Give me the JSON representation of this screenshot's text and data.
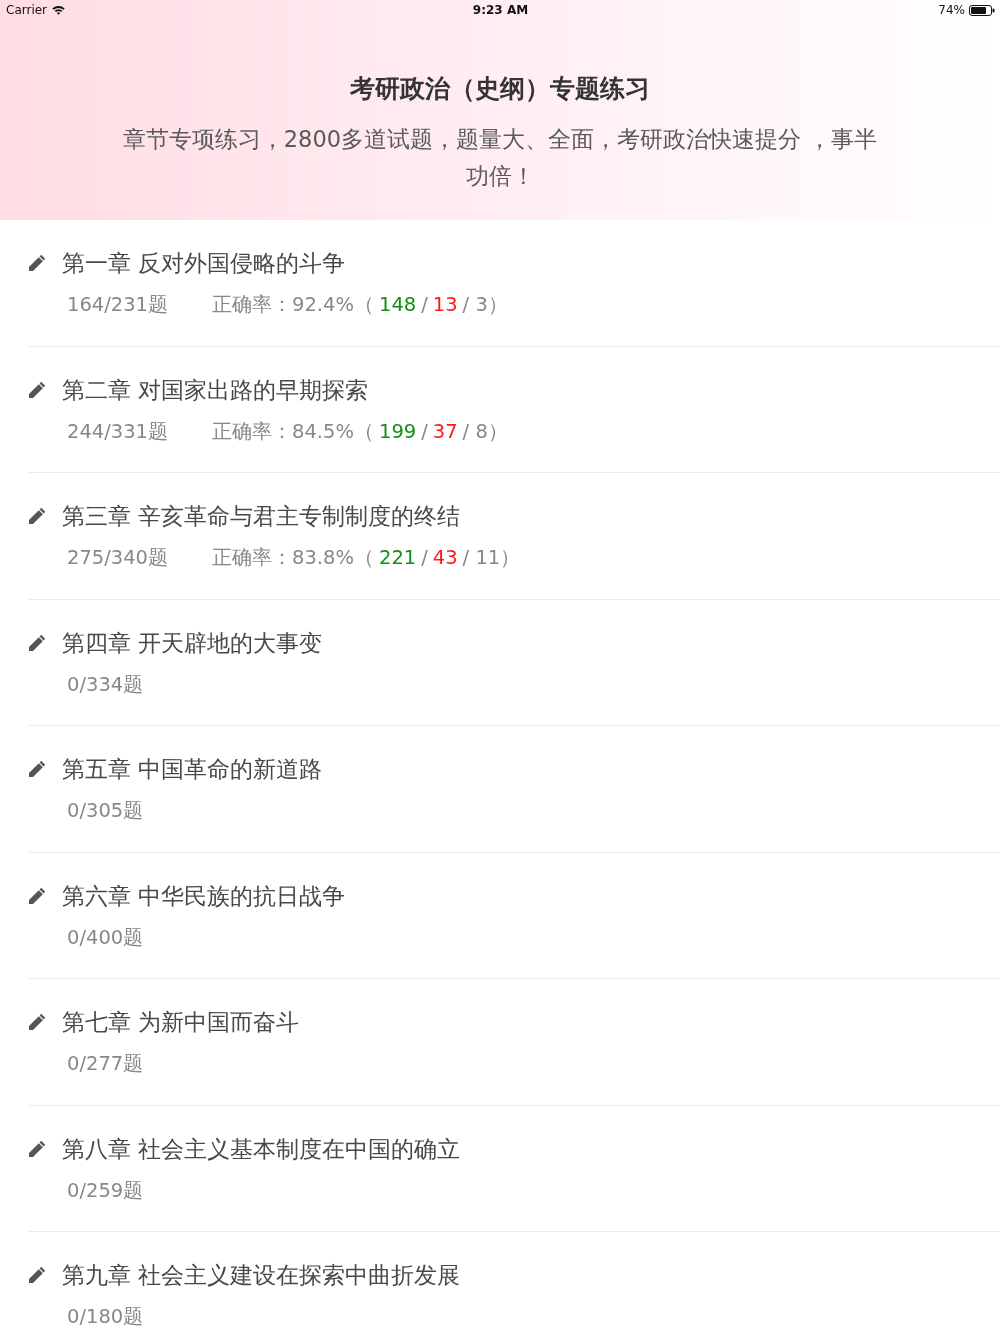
{
  "status_bar": {
    "carrier": "Carrier",
    "time": "9:23 AM",
    "battery": "74%"
  },
  "header": {
    "title": "考研政治（史纲）专题练习",
    "subtitle": "章节专项练习，2800多道试题，题量大、全面，考研政治快速提分 ，事半功倍！"
  },
  "chapters": [
    {
      "title": "第一章 反对外国侵略的斗争",
      "count": "164/231题",
      "stats": [
        {
          "kind": "plain",
          "text": "正确率：92.4%（"
        },
        {
          "kind": "correct",
          "text": "148"
        },
        {
          "kind": "plain",
          "text": "/"
        },
        {
          "kind": "wrong",
          "text": "13"
        },
        {
          "kind": "plain",
          "text": "/ 3）"
        }
      ]
    },
    {
      "title": "第二章 对国家出路的早期探索",
      "count": "244/331题",
      "stats": [
        {
          "kind": "plain",
          "text": "正确率：84.5%（"
        },
        {
          "kind": "correct",
          "text": "199"
        },
        {
          "kind": "plain",
          "text": "/"
        },
        {
          "kind": "wrong",
          "text": "37"
        },
        {
          "kind": "plain",
          "text": "/ 8）"
        }
      ]
    },
    {
      "title": "第三章 辛亥革命与君主专制制度的终结",
      "count": "275/340题",
      "stats": [
        {
          "kind": "plain",
          "text": "正确率：83.8%（"
        },
        {
          "kind": "correct",
          "text": "221"
        },
        {
          "kind": "plain",
          "text": "/"
        },
        {
          "kind": "wrong",
          "text": "43"
        },
        {
          "kind": "plain",
          "text": "/ 11）"
        }
      ]
    },
    {
      "title": "第四章 开天辟地的大事变",
      "count": "0/334题"
    },
    {
      "title": "第五章 中国革命的新道路",
      "count": "0/305题"
    },
    {
      "title": "第六章 中华民族的抗日战争",
      "count": "0/400题"
    },
    {
      "title": "第七章 为新中国而奋斗",
      "count": "0/277题"
    },
    {
      "title": "第八章 社会主义基本制度在中国的确立",
      "count": "0/259题"
    },
    {
      "title": "第九章 社会主义建设在探索中曲折发展",
      "count": "0/180题"
    }
  ]
}
